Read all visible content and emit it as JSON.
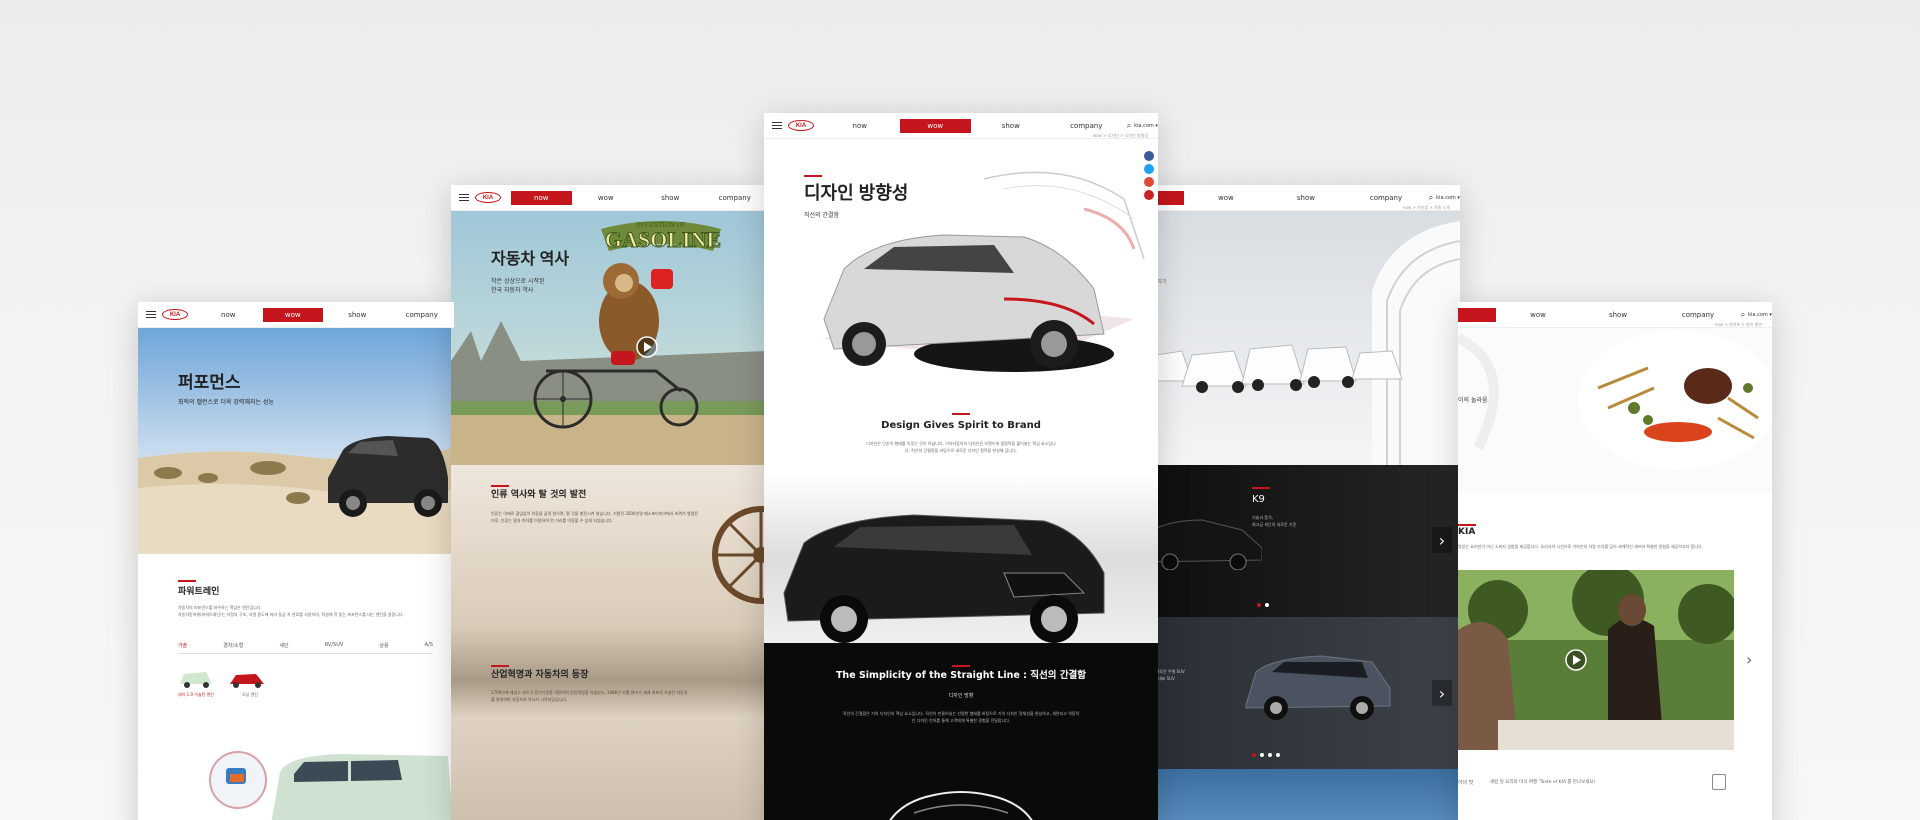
{
  "nav": {
    "now": "now",
    "wow": "wow",
    "show": "show",
    "company": "company",
    "logo": "KIA",
    "lang": "kia.com ▾"
  },
  "p1": {
    "title": "퍼포먼스",
    "subtitle": "최적의 밸런스로 더욱 강력해지는 성능",
    "section": "파워트레인",
    "section_desc": "차동차의 퍼포먼스를 좌우하는 핵심은 엔진입니다.\n자동차동력계(파워트레인)는 차량의 구조, 서열 용도에 따라 동급 차 연료를 사용하여, 학생에 적 맞는 퍼포먼스를 내는 엔진을 말합니다.",
    "tabs": [
      "가솔",
      "경차/소형",
      "세단",
      "RV/SUV",
      "상용",
      "A/S"
    ],
    "cars": [
      "레이 1.0 가솔린 엔진",
      "모닝 엔진"
    ]
  },
  "p2": {
    "title": "자동차 역사",
    "subtitle": "작은 상상으로 시작된\n한국 자동차 역사",
    "banner": "INVENTION OF",
    "banner_big": "GASOLINE",
    "s1_title": "인류 역사와 탈 것의 발전",
    "s1_text": "인류는 이래로 끊임없이 이동을 꿈꿔 왔으며, 탈 것을 발전시켜 왔습니다. 기원전 3500년경 메소포타미아에서 바퀴가 발명된 이후, 인류는 말과 마차를 이용하여 먼 거리를 이동할 수 있게 되었습니다.",
    "s2_title": "산업혁명과 자동차의 등장",
    "s2_text": "1769년에 제임스 와트가 증기기관을 개량하며 산업혁명을 이끌었고, 1886년 카를 벤츠가 세계 최초의 가솔린 자동차를 발명하며 자동차의 역사가 시작되었습니다."
  },
  "p3": {
    "breadcrumb": "wow > 디자인 > 디자인 방향성",
    "title": "디자인 방향성",
    "subtitle": "직선의 간결함",
    "s1_title": "Design Gives Spirit to Brand",
    "s1_text": "디자인은 단순히 형태를 이루는 것이 아닙니다. 기아자동차의 디자인은 브랜드에 생명력을 불어넣는 핵심 요소입니다. 직선의 간결함을 바탕으로 새로운 디자인 철학을 완성해 갑니다.",
    "s2_title": "The Simplicity of the Straight Line : 직선의 간결함",
    "s2_sub": "디자인 방향",
    "s2_text": "직선의 간결함은 기아 디자인의 핵심 요소입니다. 직선이 만들어내는 선명한 형태를 바탕으로 기아 디자인 정체성을 완성하고, 세련되고 역동적인 디자인 언어를 통해 고객에게 특별한 경험을 전달합니다."
  },
  "p4": {
    "breadcrumb": "now > 라인업 > 차종 소개",
    "title": "사",
    "subtitle": "동차 이야기",
    "k9_title": "K9",
    "k9_text": "기술과 품격,\n최고급 세단의 새로운 기준",
    "suv_text": "도심 속 새로운 주행 SUV\n대한민국 대표 SUV"
  },
  "p5": {
    "breadcrumb": "now > 라이프 > 맛의 향연",
    "title": "이의 놀라움",
    "kia_title": "KIA",
    "kia_text": "맛있는 요리만이 아닌 소비자 경험을 제공합니다. 요리사의 시선으로 기아만의 차량 가치를 담아 세계적인 셰프와 특별한 경험을 제공하고자 합니다.",
    "footer_label": "아의 맛",
    "footer_text": "세련 맛 요리와 미식 여행 'Taste of KIA'를 만나보세요!"
  },
  "colors": {
    "brand": "#c4161c"
  }
}
